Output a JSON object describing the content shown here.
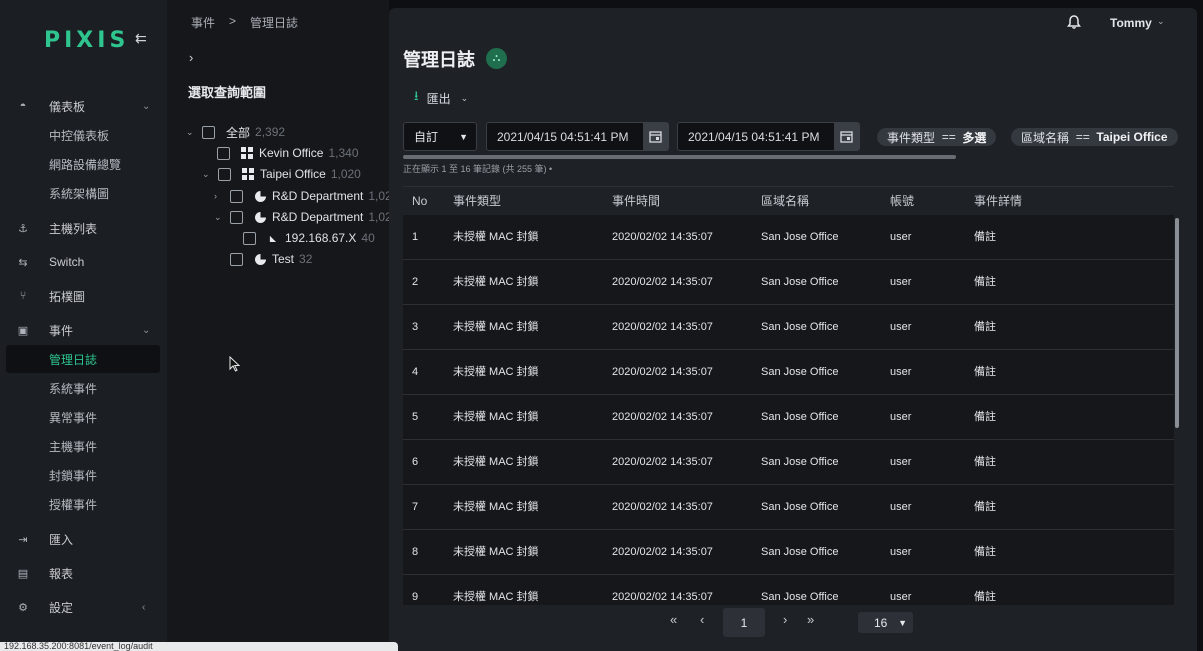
{
  "sidebar": {
    "logo": "PIXIS",
    "nav": [
      {
        "label": "儀表板",
        "icon": "dashboard-icon",
        "chev": "⌄"
      },
      {
        "label": "主機列表",
        "icon": "host-icon"
      },
      {
        "label": "Switch",
        "icon": "switch-icon"
      },
      {
        "label": "拓樸圖",
        "icon": "topology-icon"
      },
      {
        "label": "事件",
        "icon": "calendar-icon",
        "chev": "⌄"
      },
      {
        "label": "匯入",
        "icon": "import-icon"
      },
      {
        "label": "報表",
        "icon": "report-icon"
      },
      {
        "label": "設定",
        "icon": "settings-icon",
        "chev": "‹"
      }
    ],
    "dashboard_sub": [
      "中控儀表板",
      "網路設備總覽",
      "系統架構圖"
    ],
    "event_sub": [
      "管理日誌",
      "系統事件",
      "異常事件",
      "主機事件",
      "封鎖事件",
      "授權事件"
    ]
  },
  "statusbar": {
    "url": "192.168.35.200:8081/event_log/audit"
  },
  "breadcrumb": [
    "事件",
    ">",
    "管理日誌"
  ],
  "tree": {
    "title": "選取查詢範圍",
    "nodes": [
      {
        "label": "全部",
        "count": "2,392"
      },
      {
        "label": "Kevin Office",
        "count": "1,340"
      },
      {
        "label": "Taipei Office",
        "count": "1,020"
      },
      {
        "label": "R&D Department",
        "count": "1,02"
      },
      {
        "label": "R&D Department",
        "count": "1,02"
      },
      {
        "label": "192.168.67.X",
        "count": "40"
      },
      {
        "label": "Test",
        "count": "32"
      }
    ]
  },
  "header": {
    "user": "Tommy"
  },
  "main": {
    "title": "管理日誌",
    "export_label": "匯出",
    "range_select": "自訂",
    "date_from": "2021/04/15 04:51:41 PM",
    "date_to": "2021/04/15 04:51:41 PM",
    "filters": [
      {
        "key": "事件類型",
        "op": "==",
        "value": "多選"
      },
      {
        "key": "區域名稱",
        "op": "==",
        "value": "Taipei Office"
      }
    ],
    "record_info": "正在顯示 1 至 16 筆記錄 (共 255 筆) •"
  },
  "table": {
    "columns": [
      "No",
      "事件類型",
      "事件時間",
      "區域名稱",
      "帳號",
      "事件詳情"
    ],
    "rows": [
      [
        "1",
        "未授權 MAC 封鎖",
        "2020/02/02 14:35:07",
        "San Jose Office",
        "user",
        "備註"
      ],
      [
        "2",
        "未授權 MAC 封鎖",
        "2020/02/02 14:35:07",
        "San Jose Office",
        "user",
        "備註"
      ],
      [
        "3",
        "未授權 MAC 封鎖",
        "2020/02/02 14:35:07",
        "San Jose Office",
        "user",
        "備註"
      ],
      [
        "4",
        "未授權 MAC 封鎖",
        "2020/02/02 14:35:07",
        "San Jose Office",
        "user",
        "備註"
      ],
      [
        "5",
        "未授權 MAC 封鎖",
        "2020/02/02 14:35:07",
        "San Jose Office",
        "user",
        "備註"
      ],
      [
        "6",
        "未授權 MAC 封鎖",
        "2020/02/02 14:35:07",
        "San Jose Office",
        "user",
        "備註"
      ],
      [
        "7",
        "未授權 MAC 封鎖",
        "2020/02/02 14:35:07",
        "San Jose Office",
        "user",
        "備註"
      ],
      [
        "8",
        "未授權 MAC 封鎖",
        "2020/02/02 14:35:07",
        "San Jose Office",
        "user",
        "備註"
      ],
      [
        "9",
        "未授權 MAC 封鎖",
        "2020/02/02 14:35:07",
        "San Jose Office",
        "user",
        "備註"
      ]
    ]
  },
  "pager": {
    "first": "«",
    "prev": "‹",
    "current": "1",
    "next": "›",
    "last": "»",
    "page_size": "16"
  },
  "colors": {
    "accent": "#2fc58f",
    "sidebar_bg": "#1b1e23",
    "panel_bg": "#1e2126"
  }
}
